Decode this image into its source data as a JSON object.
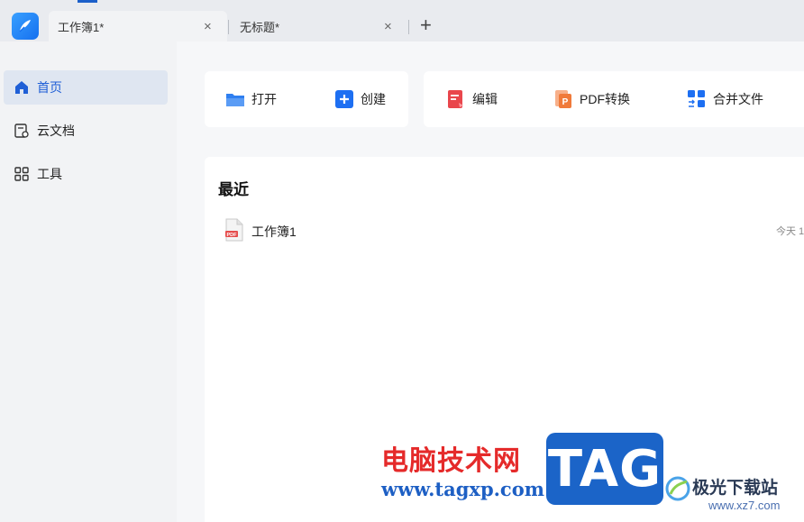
{
  "tabs": [
    {
      "label": "工作簿1*",
      "close": "×",
      "active": true
    },
    {
      "label": "无标题*",
      "close": "×",
      "active": false
    }
  ],
  "new_tab": "+",
  "sidebar": {
    "items": [
      {
        "label": "首页",
        "icon": "home-icon",
        "active": true
      },
      {
        "label": "云文档",
        "icon": "cloud-doc-icon",
        "active": false
      },
      {
        "label": "工具",
        "icon": "tools-grid-icon",
        "active": false
      }
    ]
  },
  "actions": {
    "open": "打开",
    "create": "创建",
    "edit": "编辑",
    "pdf_convert": "PDF转换",
    "merge": "合并文件"
  },
  "recent": {
    "title": "最近",
    "files": [
      {
        "name": "工作簿1",
        "time": "今天 1",
        "icon": "pdf-file-icon"
      }
    ]
  },
  "watermark": {
    "site_name": "电脑技术网",
    "url": "www.tagxp.com",
    "badge": "TAG",
    "secondary_name": "极光下载站",
    "secondary_url": "www.xz7.com"
  },
  "colors": {
    "accent": "#1f5fd6",
    "sidebar_active_bg": "#dfe6f1",
    "open_icon": "#2f7ff0",
    "create_icon": "#1d6ff2",
    "edit_icon": "#e9464c",
    "pdf_icon": "#f07a3a",
    "merge_icon": "#1d6ff2"
  }
}
